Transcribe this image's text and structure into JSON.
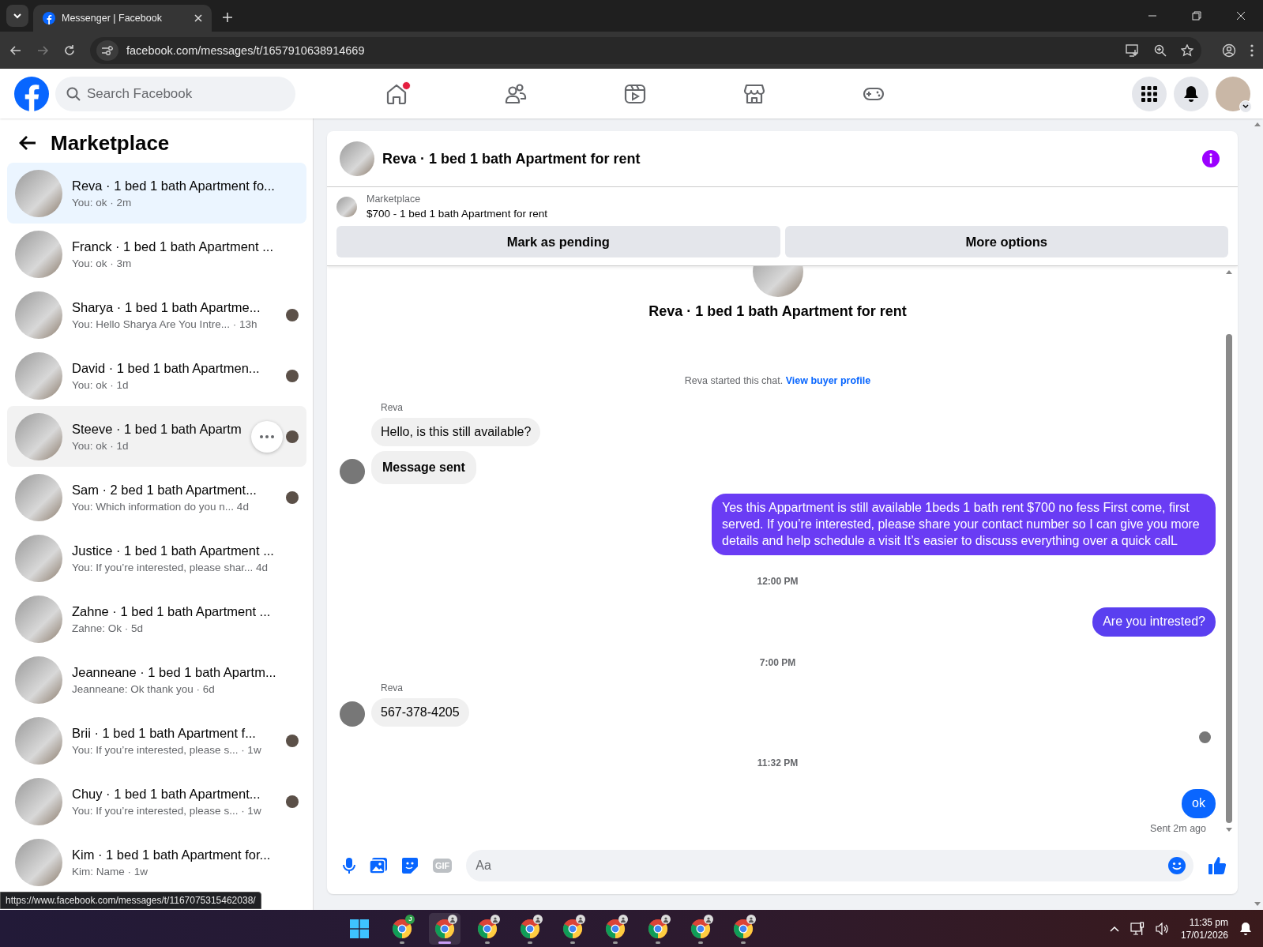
{
  "browser": {
    "tab_title": "Messenger | Facebook",
    "url": "facebook.com/messages/t/1657910638914669",
    "status_url": "https://www.facebook.com/messages/t/1167075315462038/"
  },
  "header": {
    "search": {
      "placeholder": "Search Facebook"
    },
    "nav": [
      {
        "kind": "home",
        "notification_dot": true
      },
      {
        "kind": "friends",
        "notification_dot": false
      },
      {
        "kind": "video",
        "notification_dot": false
      },
      {
        "kind": "marketplace",
        "notification_dot": false
      },
      {
        "kind": "gaming",
        "notification_dot": false
      }
    ]
  },
  "sidebar": {
    "title": "Marketplace",
    "conversations": [
      {
        "title": "Reva · 1 bed 1 bath Apartment fo...",
        "subtitle": "You: ok · 2m",
        "selected": true,
        "hovered": false,
        "seen_avatar": false
      },
      {
        "title": "Franck · 1 bed 1 bath Apartment ...",
        "subtitle": "You: ok · 3m",
        "selected": false,
        "hovered": false,
        "seen_avatar": false
      },
      {
        "title": "Sharya · 1 bed 1 bath Apartme...",
        "subtitle": "You: Hello Sharya Are You Intre... · 13h",
        "selected": false,
        "hovered": false,
        "seen_avatar": true
      },
      {
        "title": "David · 1 bed 1 bath Apartmen...",
        "subtitle": "You: ok · 1d",
        "selected": false,
        "hovered": false,
        "seen_avatar": true
      },
      {
        "title": "Steeve · 1 bed 1 bath Apartm",
        "subtitle": "You: ok · 1d",
        "selected": false,
        "hovered": true,
        "seen_avatar": true
      },
      {
        "title": "Sam · 2 bed 1 bath Apartment...",
        "subtitle": "You: Which information do you n... 4d",
        "selected": false,
        "hovered": false,
        "seen_avatar": true
      },
      {
        "title": "Justice · 1 bed 1 bath Apartment ...",
        "subtitle": "You: If you’re interested, please shar... 4d",
        "selected": false,
        "hovered": false,
        "seen_avatar": false
      },
      {
        "title": "Zahne · 1 bed 1 bath Apartment ...",
        "subtitle": "Zahne: Ok · 5d",
        "selected": false,
        "hovered": false,
        "seen_avatar": false
      },
      {
        "title": "Jeanneane · 1 bed 1 bath Apartm...",
        "subtitle": "Jeanneane: Ok thank you · 6d",
        "selected": false,
        "hovered": false,
        "seen_avatar": false
      },
      {
        "title": "Brii · 1 bed 1 bath Apartment f...",
        "subtitle": "You: If you’re interested, please s... · 1w",
        "selected": false,
        "hovered": false,
        "seen_avatar": true
      },
      {
        "title": "Chuy · 1 bed 1 bath Apartment...",
        "subtitle": "You: If you’re interested, please s... · 1w",
        "selected": false,
        "hovered": false,
        "seen_avatar": true
      },
      {
        "title": "Kim · 1 bed 1 bath Apartment for...",
        "subtitle": "Kim: Name · 1w",
        "selected": false,
        "hovered": false,
        "seen_avatar": false
      }
    ]
  },
  "chat": {
    "title": "Reva · 1 bed 1 bath Apartment for rent",
    "listing": {
      "source": "Marketplace",
      "title": "$700 - 1 bed 1 bath Apartment for rent"
    },
    "actions": [
      "Mark as pending",
      "More options"
    ],
    "thread_title": "Reva · 1 bed 1 bath Apartment for rent",
    "intro": {
      "text": "Reva started this chat.",
      "link": "View buyer profile"
    },
    "messages": [
      {
        "kind": "incoming",
        "sender": "Reva",
        "bubbles": [
          {
            "text": "Hello, is this still available?",
            "bold": false
          },
          {
            "text": "Message sent",
            "bold": true
          }
        ]
      },
      {
        "kind": "outgoing",
        "text": "Yes this Appartment is still available 1beds 1 bath rent $700 no fess First come, first served. If you’re interested, please share your contact number so I can give you more details and help schedule a visit It’s easier to discuss everything over a quick calL",
        "color": "#6a3cf4"
      },
      {
        "kind": "time",
        "text": "12:00 PM"
      },
      {
        "kind": "outgoing",
        "text": "Are you intrested?",
        "color": "#5a3ff0"
      },
      {
        "kind": "time",
        "text": "7:00 PM"
      },
      {
        "kind": "incoming",
        "sender": "Reva",
        "bubbles": [
          {
            "text": "567-378-4205",
            "bold": false
          }
        ]
      },
      {
        "kind": "seen"
      },
      {
        "kind": "time",
        "text": "11:32 PM"
      },
      {
        "kind": "outgoing",
        "text": "ok",
        "color": "#0a66ff",
        "status": "Sent 2m ago"
      }
    ],
    "composer": {
      "gif_label": "GIF",
      "placeholder": "Aa"
    }
  },
  "taskbar": {
    "apps": [
      {
        "badge": "J",
        "selected": false
      },
      {
        "selected": true
      },
      {
        "selected": false
      },
      {
        "selected": false
      },
      {
        "selected": false
      },
      {
        "selected": false
      },
      {
        "selected": false
      },
      {
        "selected": false
      },
      {
        "selected": false
      }
    ],
    "time": "11:35 pm",
    "date": "17/01/2026"
  }
}
